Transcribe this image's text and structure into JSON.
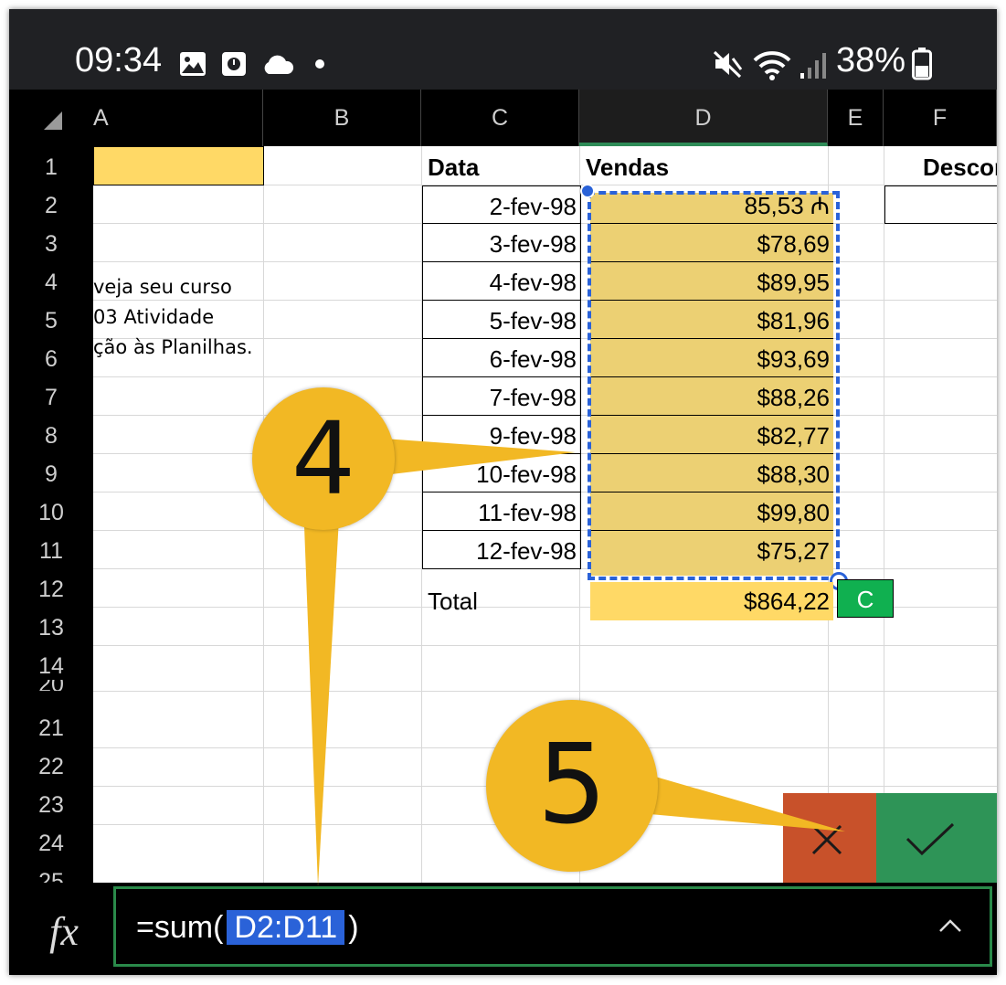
{
  "status_bar": {
    "time": "09:34",
    "battery": "38%",
    "icons": [
      "image-icon",
      "app-icon",
      "cloud-icon",
      "dot-icon",
      "mute-icon",
      "wifi-icon",
      "signal-icon",
      "battery-icon"
    ]
  },
  "columns": [
    "A",
    "B",
    "C",
    "D",
    "E",
    "F"
  ],
  "rows": [
    "1",
    "2",
    "3",
    "4",
    "5",
    "6",
    "7",
    "8",
    "9",
    "10",
    "11",
    "12",
    "13",
    "14",
    "20",
    "21",
    "22",
    "23",
    "24",
    "25"
  ],
  "sheet": {
    "header_date": "Data",
    "header_sales": "Vendas",
    "header_discount": "Descor",
    "note_lines": [
      "veja seu curso",
      "03 Atividade",
      "ção às Planilhas."
    ],
    "dates": [
      "2-fev-98",
      "3-fev-98",
      "4-fev-98",
      "5-fev-98",
      "6-fev-98",
      "7-fev-98",
      "9-fev-98",
      "10-fev-98",
      "11-fev-98",
      "12-fev-98"
    ],
    "sales": [
      "85,53 ₼",
      "$78,69",
      "$89,95",
      "$81,96",
      "$93,69",
      "$88,26",
      "$82,77",
      "$88,30",
      "$99,80",
      "$75,27"
    ],
    "total_label": "Total",
    "total_value": "$864,22",
    "autocomplete_chip": "C"
  },
  "formula_bar": {
    "fx_label": "fx",
    "formula_prefix": "=sum(",
    "formula_range": "D2:D11",
    "formula_suffix": ")",
    "expand": "^"
  },
  "actions": {
    "cancel": "×",
    "confirm": "✓"
  },
  "callouts": {
    "four": "4",
    "five": "5"
  },
  "colors": {
    "highlight": "#ffd966",
    "selection": "#2a62d8",
    "confirm": "#2e9457",
    "cancel": "#c8512a",
    "callout": "#f2b824"
  }
}
